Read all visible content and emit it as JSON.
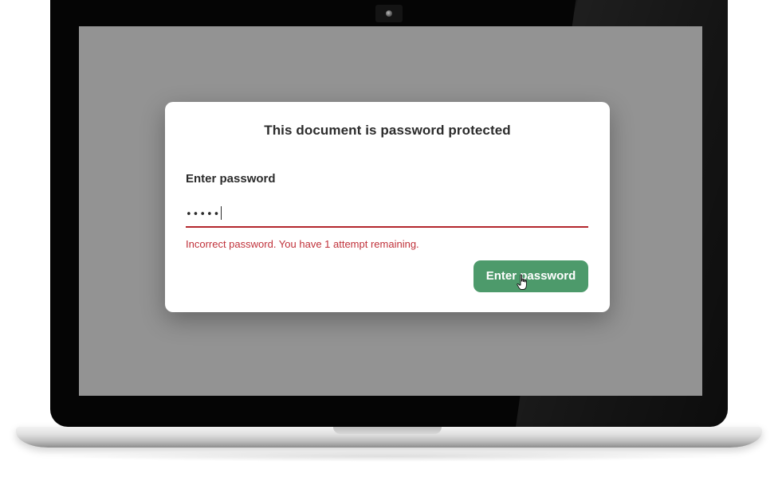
{
  "dialog": {
    "title": "This document is password protected",
    "field_label": "Enter password",
    "password_value": "•••••",
    "error_message": "Incorrect password. You have 1 attempt remaining.",
    "submit_label": "Enter password"
  },
  "colors": {
    "screen_backdrop": "#939393",
    "button": "#4d9a6b",
    "error": "#c0313a",
    "field_underline": "#b3262d"
  },
  "icons": {
    "cursor": "hand-pointer-cursor-icon",
    "camera": "webcam-icon"
  }
}
